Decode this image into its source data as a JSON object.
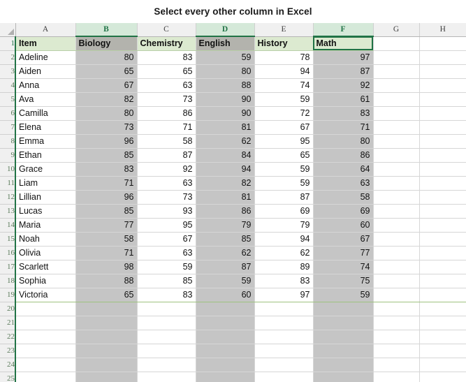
{
  "title": "Select every other column in Excel",
  "spreadsheet": {
    "column_headers": [
      "A",
      "B",
      "C",
      "D",
      "E",
      "F",
      "G",
      "H"
    ],
    "selected_columns": [
      "B",
      "D",
      "F"
    ],
    "active_cell": "F1",
    "row_numbers": [
      "1",
      "2",
      "3",
      "4",
      "5",
      "6",
      "7",
      "8",
      "9",
      "10",
      "11",
      "12",
      "13",
      "14",
      "15",
      "16",
      "17",
      "18",
      "19",
      "20",
      "21",
      "22",
      "23",
      "24",
      "25"
    ],
    "header_row": [
      "Item",
      "Biology",
      "Chemistry",
      "English",
      "History",
      "Math"
    ],
    "rows": [
      [
        "Adeline",
        "80",
        "83",
        "59",
        "78",
        "97"
      ],
      [
        "Aiden",
        "65",
        "65",
        "80",
        "94",
        "87"
      ],
      [
        "Anna",
        "67",
        "63",
        "88",
        "74",
        "92"
      ],
      [
        "Ava",
        "82",
        "73",
        "90",
        "59",
        "61"
      ],
      [
        "Camilla",
        "80",
        "86",
        "90",
        "72",
        "83"
      ],
      [
        "Elena",
        "73",
        "71",
        "81",
        "67",
        "71"
      ],
      [
        "Emma",
        "96",
        "58",
        "62",
        "95",
        "80"
      ],
      [
        "Ethan",
        "85",
        "87",
        "84",
        "65",
        "86"
      ],
      [
        "Grace",
        "83",
        "92",
        "94",
        "59",
        "64"
      ],
      [
        "Liam",
        "71",
        "63",
        "82",
        "59",
        "63"
      ],
      [
        "Lillian",
        "96",
        "73",
        "81",
        "87",
        "58"
      ],
      [
        "Lucas",
        "85",
        "93",
        "86",
        "69",
        "69"
      ],
      [
        "Maria",
        "77",
        "95",
        "79",
        "79",
        "60"
      ],
      [
        "Noah",
        "58",
        "67",
        "85",
        "94",
        "67"
      ],
      [
        "Olivia",
        "71",
        "63",
        "62",
        "62",
        "77"
      ],
      [
        "Scarlett",
        "98",
        "59",
        "87",
        "89",
        "74"
      ],
      [
        "Sophia",
        "88",
        "85",
        "59",
        "83",
        "75"
      ],
      [
        "Victoria",
        "65",
        "83",
        "60",
        "97",
        "59"
      ]
    ],
    "empty_row_count": 6,
    "colors": {
      "selection_gray": "#c5c5c5",
      "header_green": "#dcead0",
      "accent_green": "#217346",
      "colhead_selected": "#d5e9d9",
      "colhead_normal": "#f0f0f0"
    }
  }
}
